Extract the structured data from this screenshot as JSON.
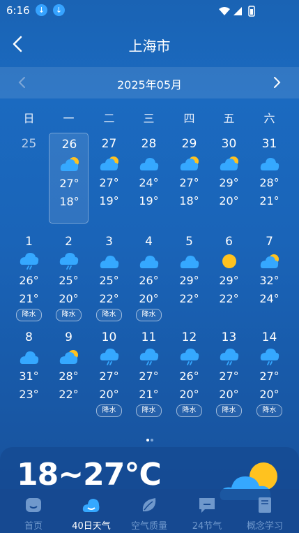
{
  "status_bar": {
    "time": "6:16"
  },
  "header": {
    "title": "上海市"
  },
  "month_bar": {
    "label": "2025年05月"
  },
  "weekdays": [
    "日",
    "一",
    "二",
    "三",
    "四",
    "五",
    "六"
  ],
  "calendar": [
    {
      "day": "25",
      "icon": "",
      "hi": "",
      "lo": "",
      "rain": ""
    },
    {
      "day": "26",
      "icon": "partly-cloudy",
      "hi": "27°",
      "lo": "18°",
      "rain": ""
    },
    {
      "day": "27",
      "icon": "partly-cloudy",
      "hi": "27°",
      "lo": "19°",
      "rain": ""
    },
    {
      "day": "28",
      "icon": "cloudy",
      "hi": "24°",
      "lo": "19°",
      "rain": ""
    },
    {
      "day": "29",
      "icon": "partly-cloudy",
      "hi": "27°",
      "lo": "18°",
      "rain": ""
    },
    {
      "day": "30",
      "icon": "partly-cloudy",
      "hi": "29°",
      "lo": "20°",
      "rain": ""
    },
    {
      "day": "31",
      "icon": "cloudy",
      "hi": "28°",
      "lo": "21°",
      "rain": ""
    },
    {
      "day": "1",
      "icon": "rain",
      "hi": "26°",
      "lo": "21°",
      "rain": "降水"
    },
    {
      "day": "2",
      "icon": "rain",
      "hi": "25°",
      "lo": "20°",
      "rain": "降水"
    },
    {
      "day": "3",
      "icon": "cloudy",
      "hi": "25°",
      "lo": "22°",
      "rain": "降水"
    },
    {
      "day": "4",
      "icon": "cloudy",
      "hi": "26°",
      "lo": "20°",
      "rain": "降水"
    },
    {
      "day": "5",
      "icon": "cloudy",
      "hi": "29°",
      "lo": "22°",
      "rain": ""
    },
    {
      "day": "6",
      "icon": "sunny",
      "hi": "29°",
      "lo": "22°",
      "rain": ""
    },
    {
      "day": "7",
      "icon": "partly-cloudy",
      "hi": "32°",
      "lo": "24°",
      "rain": ""
    },
    {
      "day": "8",
      "icon": "cloudy",
      "hi": "31°",
      "lo": "23°",
      "rain": ""
    },
    {
      "day": "9",
      "icon": "partly-cloudy",
      "hi": "28°",
      "lo": "22°",
      "rain": ""
    },
    {
      "day": "10",
      "icon": "rain",
      "hi": "27°",
      "lo": "20°",
      "rain": "降水"
    },
    {
      "day": "11",
      "icon": "rain",
      "hi": "27°",
      "lo": "21°",
      "rain": "降水"
    },
    {
      "day": "12",
      "icon": "rain",
      "hi": "26°",
      "lo": "20°",
      "rain": "降水"
    },
    {
      "day": "13",
      "icon": "rain",
      "hi": "27°",
      "lo": "20°",
      "rain": "降水"
    },
    {
      "day": "14",
      "icon": "rain",
      "hi": "27°",
      "lo": "20°",
      "rain": "降水"
    }
  ],
  "summary": {
    "range": "18~27℃"
  },
  "tabs": [
    {
      "label": "首页",
      "icon": "home-icon"
    },
    {
      "label": "40日天气",
      "icon": "weather-icon"
    },
    {
      "label": "空气质量",
      "icon": "leaf-icon"
    },
    {
      "label": "24节气",
      "icon": "message-icon"
    },
    {
      "label": "概念学习",
      "icon": "book-icon"
    }
  ],
  "colors": {
    "accent": "#2f9bff",
    "sun": "#ffc21f",
    "cloud": "#35a8ff"
  }
}
